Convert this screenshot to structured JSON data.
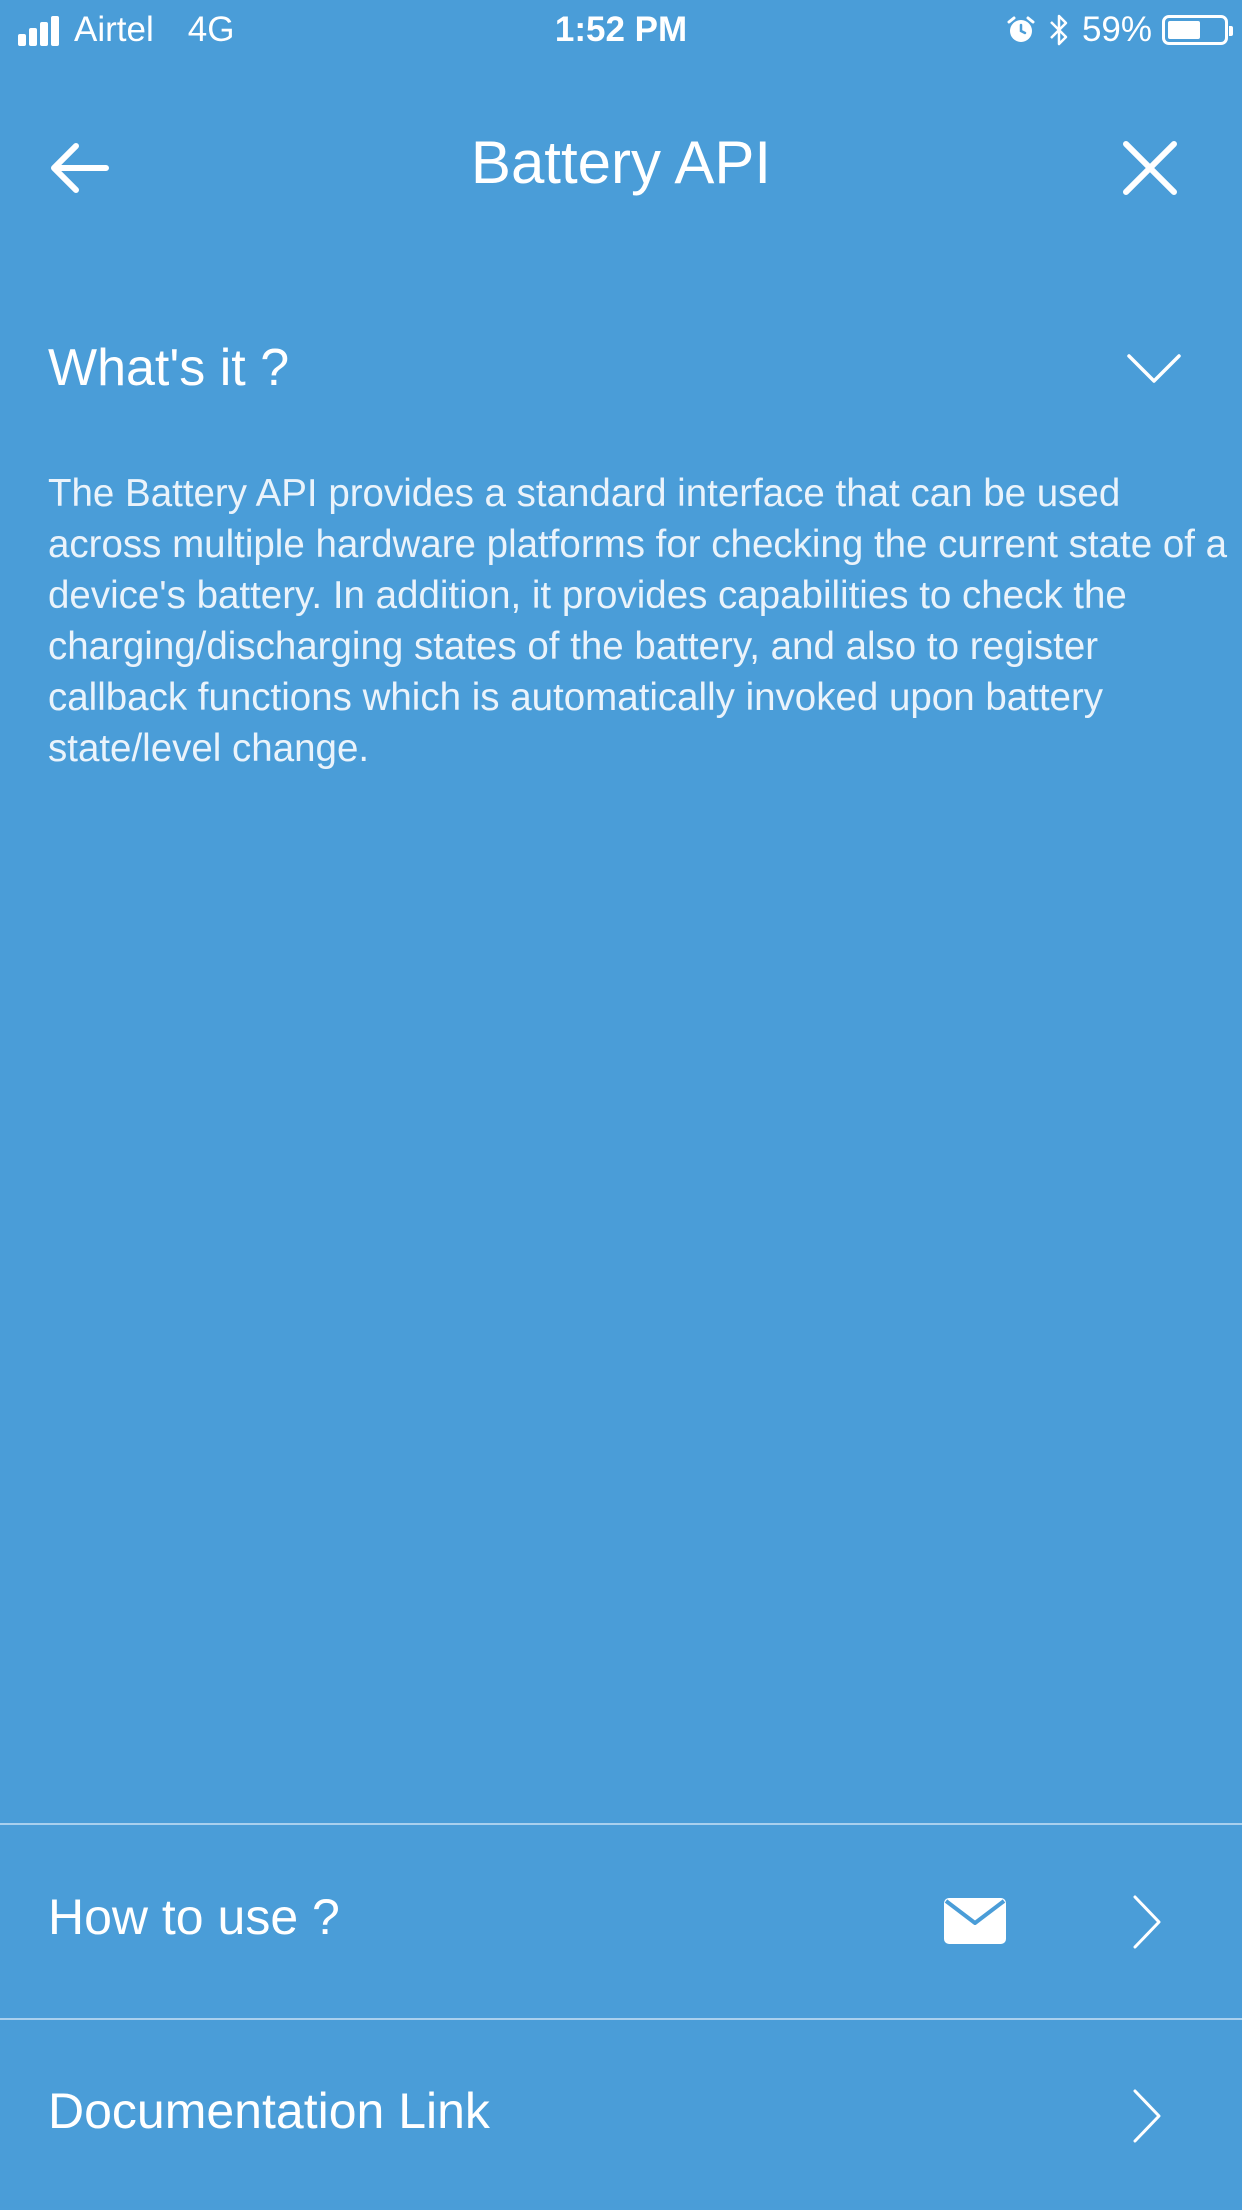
{
  "status_bar": {
    "carrier": "Airtel",
    "network": "4G",
    "time": "1:52 PM",
    "battery_percent": "59%",
    "battery_level": 0.59
  },
  "nav": {
    "title": "Battery API",
    "back_icon": "arrow-left-icon",
    "close_icon": "close-icon"
  },
  "section": {
    "title": "What's it ?",
    "expand_icon": "chevron-down-icon",
    "description": "The Battery API provides a standard interface that can be used across multiple hardware platforms for checking the current state of a device's battery. In addition, it provides capabilities to check the charging/discharging states of the battery, and also to register callback functions which is automatically invoked upon battery state/level change."
  },
  "list": {
    "items": [
      {
        "label": "How to use ?",
        "icons": [
          "mail-icon",
          "chevron-right-icon"
        ]
      },
      {
        "label": "Documentation Link",
        "icons": [
          "chevron-right-icon"
        ]
      }
    ]
  },
  "colors": {
    "background": "#4a9dd8",
    "text": "#ffffff",
    "divider": "#a9d0ee"
  }
}
